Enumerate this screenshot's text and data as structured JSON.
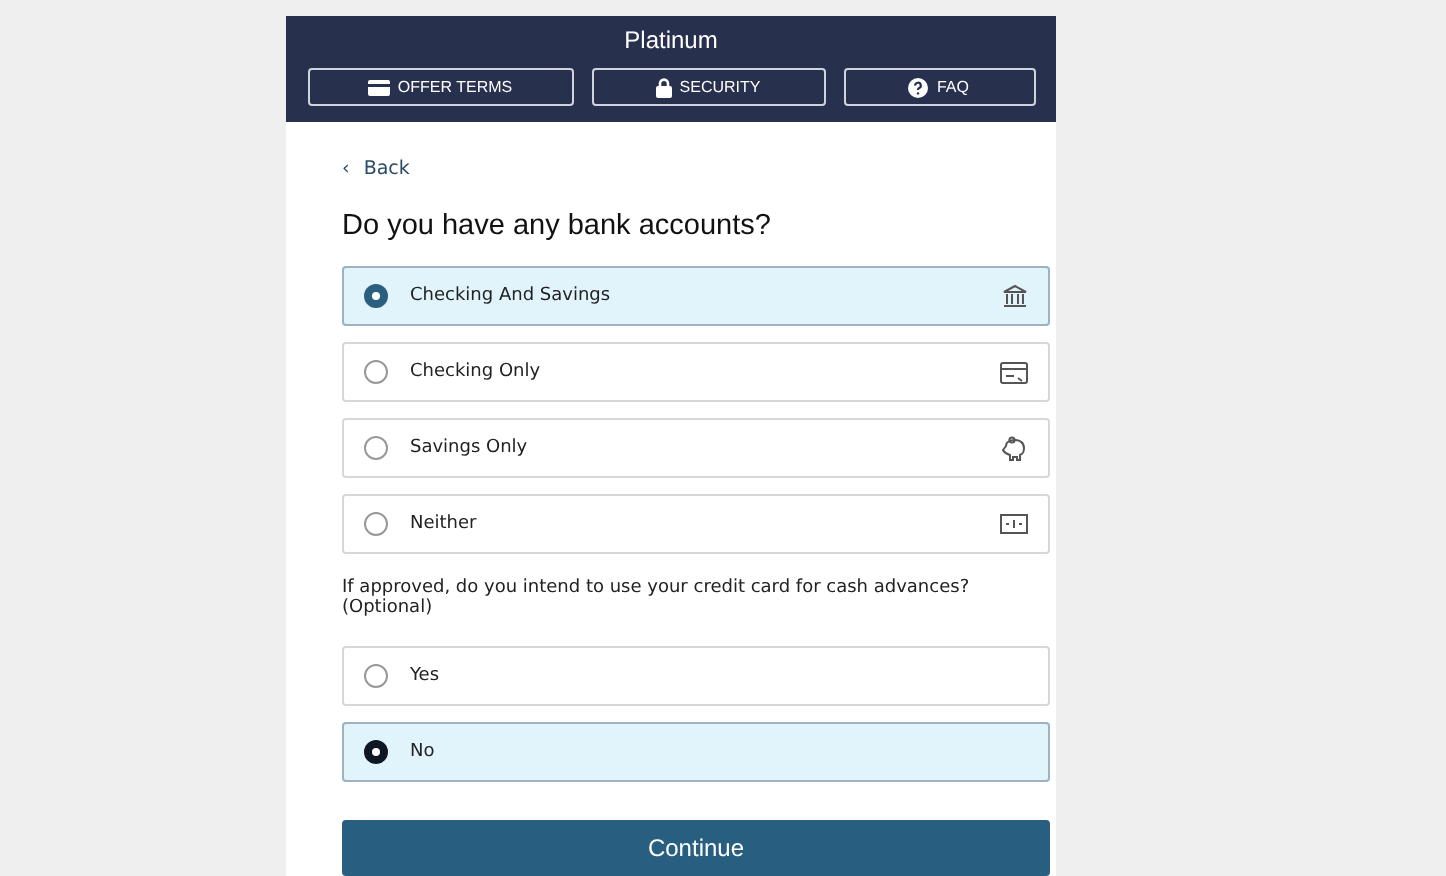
{
  "header": {
    "title": "Platinum",
    "buttons": [
      {
        "label": "OFFER TERMS"
      },
      {
        "label": "SECURITY"
      },
      {
        "label": "FAQ"
      }
    ]
  },
  "back": {
    "icon": "‹",
    "label": "Back"
  },
  "questions": [
    {
      "text": "Do you have any bank accounts?",
      "kind": "heading",
      "options": [
        {
          "label": "Checking And Savings",
          "selected": true
        },
        {
          "label": "Checking Only",
          "selected": false
        },
        {
          "label": "Savings Only",
          "selected": false
        },
        {
          "label": "Neither",
          "selected": false
        }
      ]
    },
    {
      "text": "If approved, do you intend to use your credit card for cash advances? (Optional)",
      "kind": "plain",
      "options": [
        {
          "label": "Yes",
          "selected": false
        },
        {
          "label": "No",
          "selected": true
        }
      ]
    }
  ],
  "continue_button": "Continue"
}
